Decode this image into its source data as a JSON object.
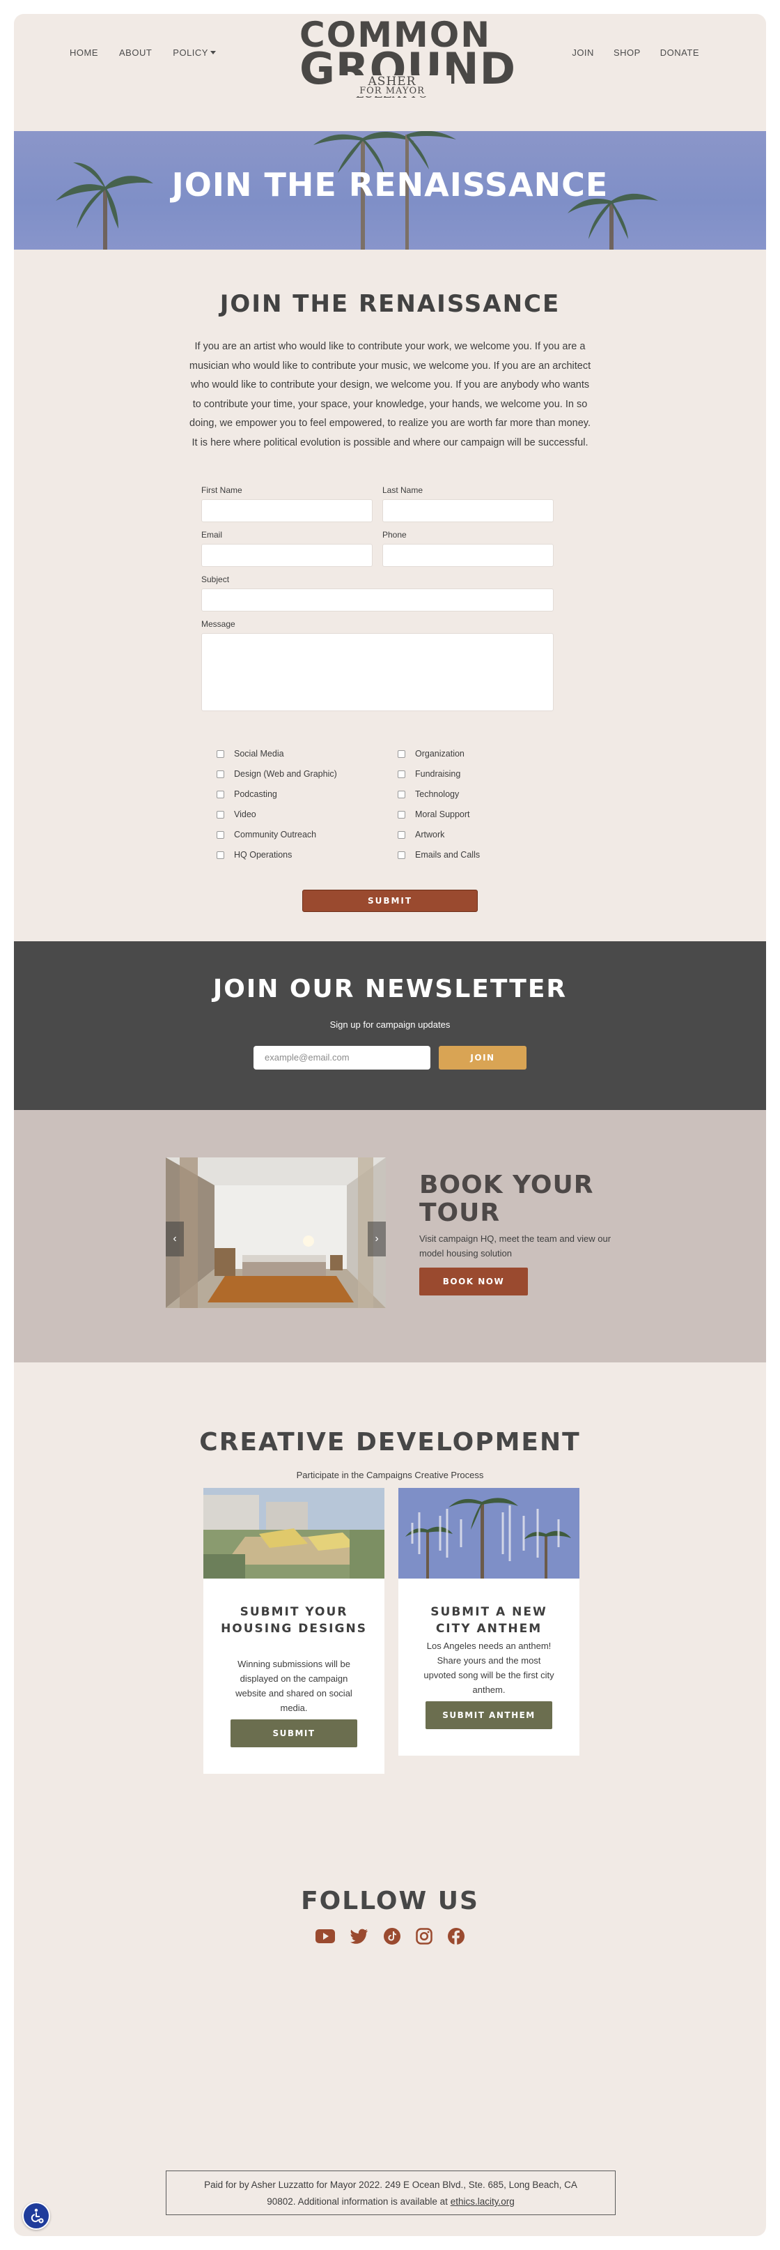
{
  "nav": {
    "home": "HOME",
    "about": "ABOUT",
    "policy": "POLICY",
    "join": "JOIN",
    "shop": "SHOP",
    "donate": "DONATE"
  },
  "logo": {
    "line1": "COMMON",
    "line2": "GROUND",
    "line3": "ASHER LUZZATTO",
    "line4": "FOR MAYOR"
  },
  "hero": {
    "title": "JOIN THE RENAISSANCE"
  },
  "join": {
    "title": "JOIN THE RENAISSANCE",
    "text": "If you are an artist who would like to contribute your work, we welcome you. If you are a musician who would like to contribute your music, we welcome you. If you are an architect who would like to contribute your design, we welcome you. If you are anybody who wants to contribute your time, your space, your knowledge, your hands, we welcome you. In so doing, we empower you to feel empowered, to realize you are worth far more than money. It is here where political evolution is possible and where our campaign will be successful.",
    "labels": {
      "first_name": "First Name",
      "last_name": "Last Name",
      "email": "Email",
      "phone": "Phone",
      "subject": "Subject",
      "message": "Message"
    },
    "checkboxes_left": [
      "Social Media",
      "Design (Web and Graphic)",
      "Podcasting",
      "Video",
      "Community Outreach",
      "HQ Operations"
    ],
    "checkboxes_right": [
      "Organization",
      "Fundraising",
      "Technology",
      "Moral Support",
      "Artwork",
      "Emails and Calls"
    ],
    "submit": "SUBMIT"
  },
  "newsletter": {
    "title": "JOIN OUR NEWSLETTER",
    "subtitle": "Sign up for campaign updates",
    "placeholder": "example@email.com",
    "button": "JOIN"
  },
  "tour": {
    "title_line1": "BOOK YOUR",
    "title_line2": "TOUR",
    "description": "Visit campaign HQ, meet the team and view our model housing solution",
    "button": "BOOK NOW",
    "prev_icon": "chevron-left-icon",
    "next_icon": "chevron-right-icon"
  },
  "creative": {
    "title": "CREATIVE DEVELOPMENT",
    "subtitle": "Participate in the Campaigns Creative Process",
    "cards": [
      {
        "title": "SUBMIT YOUR HOUSING DESIGNS",
        "text": "Winning submissions will be displayed on the campaign website and shared on social media.",
        "button": "SUBMIT"
      },
      {
        "title": "SUBMIT A NEW CITY ANTHEM",
        "text": "Los Angeles needs an anthem! Share yours and the most upvoted song will be the first city anthem.",
        "button": "SUBMIT ANTHEM"
      }
    ]
  },
  "follow": {
    "title": "FOLLOW US",
    "icons": [
      "youtube-icon",
      "twitter-icon",
      "tiktok-icon",
      "instagram-icon",
      "facebook-icon"
    ]
  },
  "footer": {
    "line1": "Paid for by Asher Luzzatto for Mayor 2022. 249 E Ocean Blvd., Ste. 685, Long Beach, CA",
    "line2_prefix": "90802. Additional information is available at ",
    "link": "ethics.lacity.org"
  },
  "colors": {
    "page_bg": "#f1eae5",
    "accent_rust": "#9a4a2f",
    "accent_gold": "#d9a454",
    "accent_olive": "#6b6e4f",
    "dark_band": "#4a4a4a",
    "tour_band": "#cbc0bc"
  }
}
